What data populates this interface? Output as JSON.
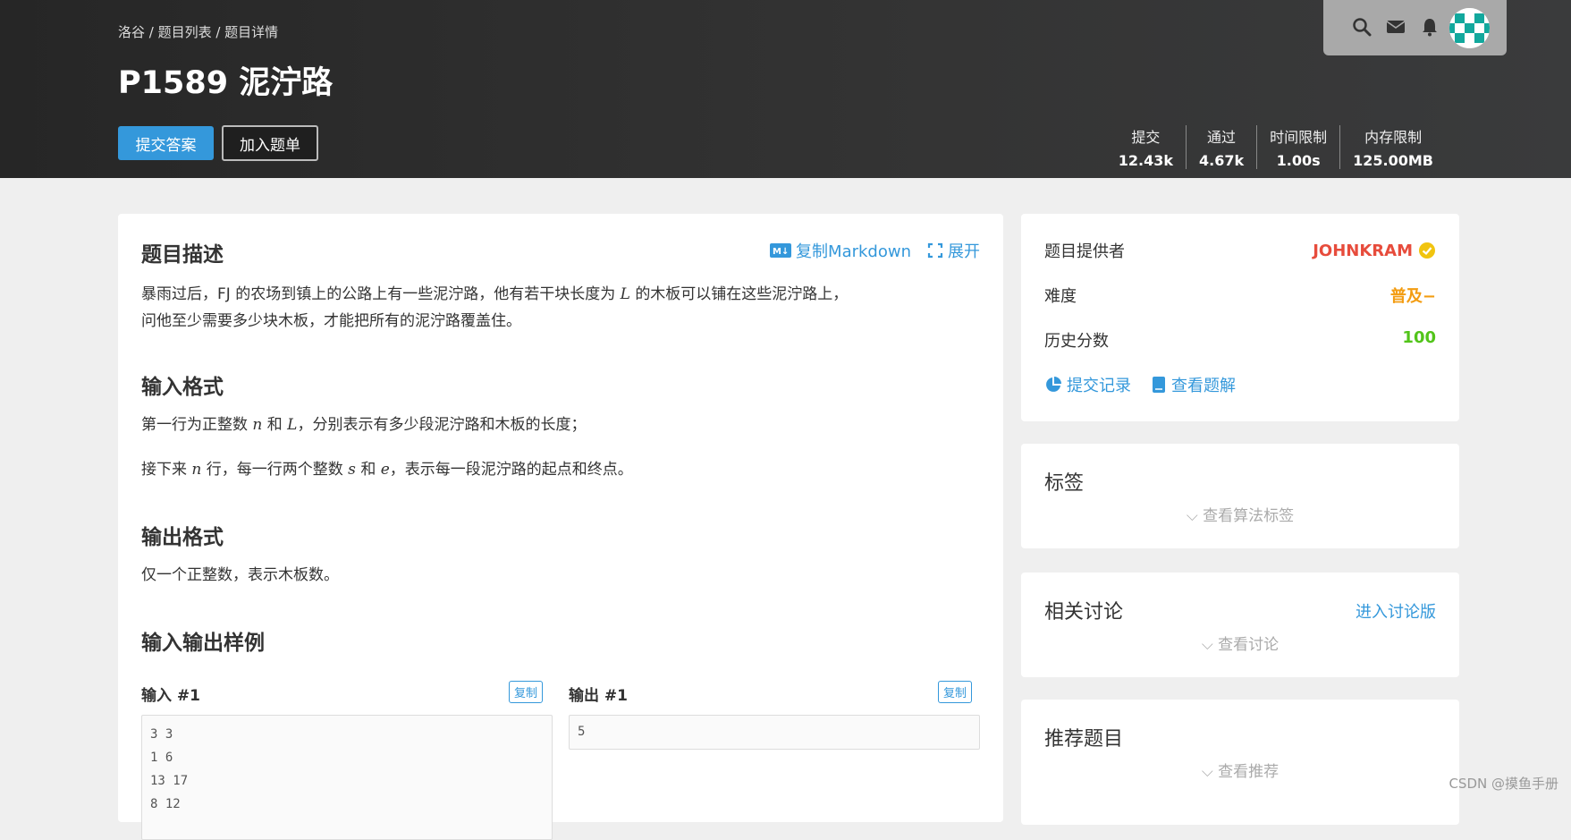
{
  "header": {
    "breadcrumb": "洛谷 / 题目列表 / 题目详情",
    "title": "P1589 泥泞路",
    "submit_button": "提交答案",
    "add_list_button": "加入题单",
    "stats": [
      {
        "label": "提交",
        "value": "12.43k"
      },
      {
        "label": "通过",
        "value": "4.67k"
      },
      {
        "label": "时间限制",
        "value": "1.00s"
      },
      {
        "label": "内存限制",
        "value": "125.00MB"
      }
    ],
    "topbar_icons": [
      "search-icon",
      "mail-icon",
      "bell-icon",
      "avatar"
    ]
  },
  "problem": {
    "desc_heading": "题目描述",
    "copy_markdown": "复制Markdown",
    "expand": "展开",
    "desc_p1_a": "暴雨过后，FJ 的农场到镇上的公路上有一些泥泞路，他有若干块长度为",
    "desc_p1_var": "L",
    "desc_p1_b": "的木板可以铺在这些泥泞路上，",
    "desc_p2": "问他至少需要多少块木板，才能把所有的泥泞路覆盖住。",
    "input_heading": "输入格式",
    "input_l1_a": "第一行为正整数",
    "input_l1_v1": "n",
    "input_l1_b": "和",
    "input_l1_v2": "L",
    "input_l1_c": "，分别表示有多少段泥泞路和木板的长度；",
    "input_l2_a": "接下来",
    "input_l2_v1": "n",
    "input_l2_b": "行，每一行两个整数",
    "input_l2_v2": "s",
    "input_l2_c": "和",
    "input_l2_v3": "e",
    "input_l2_d": "，表示每一段泥泞路的起点和终点。",
    "output_heading": "输出格式",
    "output_text": "仅一个正整数，表示木板数。",
    "samples_heading": "输入输出样例",
    "input_label": "输入 #1",
    "output_label": "输出 #1",
    "copy_label": "复制",
    "sample_input": "3 3\n1 6\n13 17\n8 12",
    "sample_output": "5"
  },
  "sidebar": {
    "provider_label": "题目提供者",
    "provider_name": "JOHNKRAM",
    "difficulty_label": "难度",
    "difficulty_value": "普及−",
    "score_label": "历史分数",
    "score_value": "100",
    "records_link": "提交记录",
    "solutions_link": "查看题解",
    "tags_title": "标签",
    "tags_fold": "查看算法标签",
    "discuss_title": "相关讨论",
    "discuss_link": "进入讨论版",
    "discuss_fold": "查看讨论",
    "recommend_title": "推荐题目",
    "recommend_fold": "查看推荐"
  },
  "watermark": "CSDN @摸鱼手册",
  "colors": {
    "accent": "#3498db",
    "provider": "#e74c3c",
    "difficulty": "#f39c11",
    "score": "#52c41a"
  }
}
